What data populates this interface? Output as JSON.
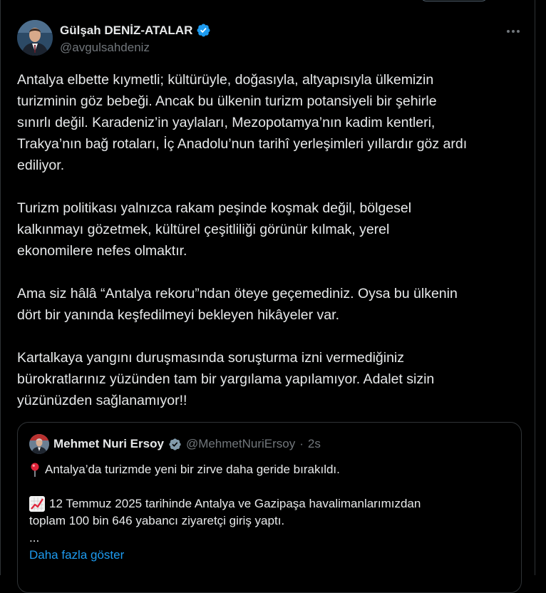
{
  "author": {
    "name": "Gülşah DENİZ-ATALAR",
    "handle": "@avgulsahdeniz"
  },
  "tweet": {
    "paragraphs": [
      "Antalya elbette kıymetli; kültürüyle, doğasıyla, altyapısıyla ülkemizin\nturizminin göz bebeği. Ancak bu ülkenin turizm potansiyeli bir şehirle\nsınırlı değil. Karadeniz’in yaylaları, Mezopotamya’nın kadim kentleri,\nTrakya’nın bağ rotaları, İç Anadolu’nun tarihî yerleşimleri yıllardır göz ardı\nediliyor.",
      "Turizm politikası yalnızca rakam peşinde koşmak değil, bölgesel\nkalkınmayı gözetmek, kültürel çeşitliliği görünür kılmak, yerel\nekonomilere nefes olmaktır.",
      "Ama siz hâlâ “Antalya rekoru”ndan öteye geçemediniz. Oysa bu ülkenin\ndört bir yanında keşfedilmeyi bekleyen hikâyeler var.",
      "Kartalkaya yangını duruşmasında soruşturma izni vermediğiniz\nbürokratlarınız yüzünden tam bir yargılama yapılamıyor. Adalet sizin\nyüzünüzden sağlanamıyor!!"
    ]
  },
  "quote": {
    "name": "Mehmet Nuri Ersoy",
    "handle": "@MehmetNuriErsoy",
    "separator": "·",
    "time": "2s",
    "line1": "Antalya’da turizmde yeni bir zirve daha geride bırakıldı.",
    "line2": "12 Temmuz 2025 tarihinde Antalya ve Gazipaşa havalimanlarımızdan",
    "line3": "toplam 100 bin 646 yabancı ziyaretçi giriş yaptı.",
    "ellipsis": "...",
    "show_more": "Daha fazla göster"
  },
  "icons": {
    "verified": "verified-badge-icon",
    "more": "more-icon",
    "pin": "round-pushpin-icon",
    "chart": "chart-increasing-icon"
  },
  "colors": {
    "background": "#000000",
    "text": "#e7e9ea",
    "muted": "#71767b",
    "border": "#2f3336",
    "link": "#1d9bf0",
    "verified": "#1d9bf0"
  }
}
